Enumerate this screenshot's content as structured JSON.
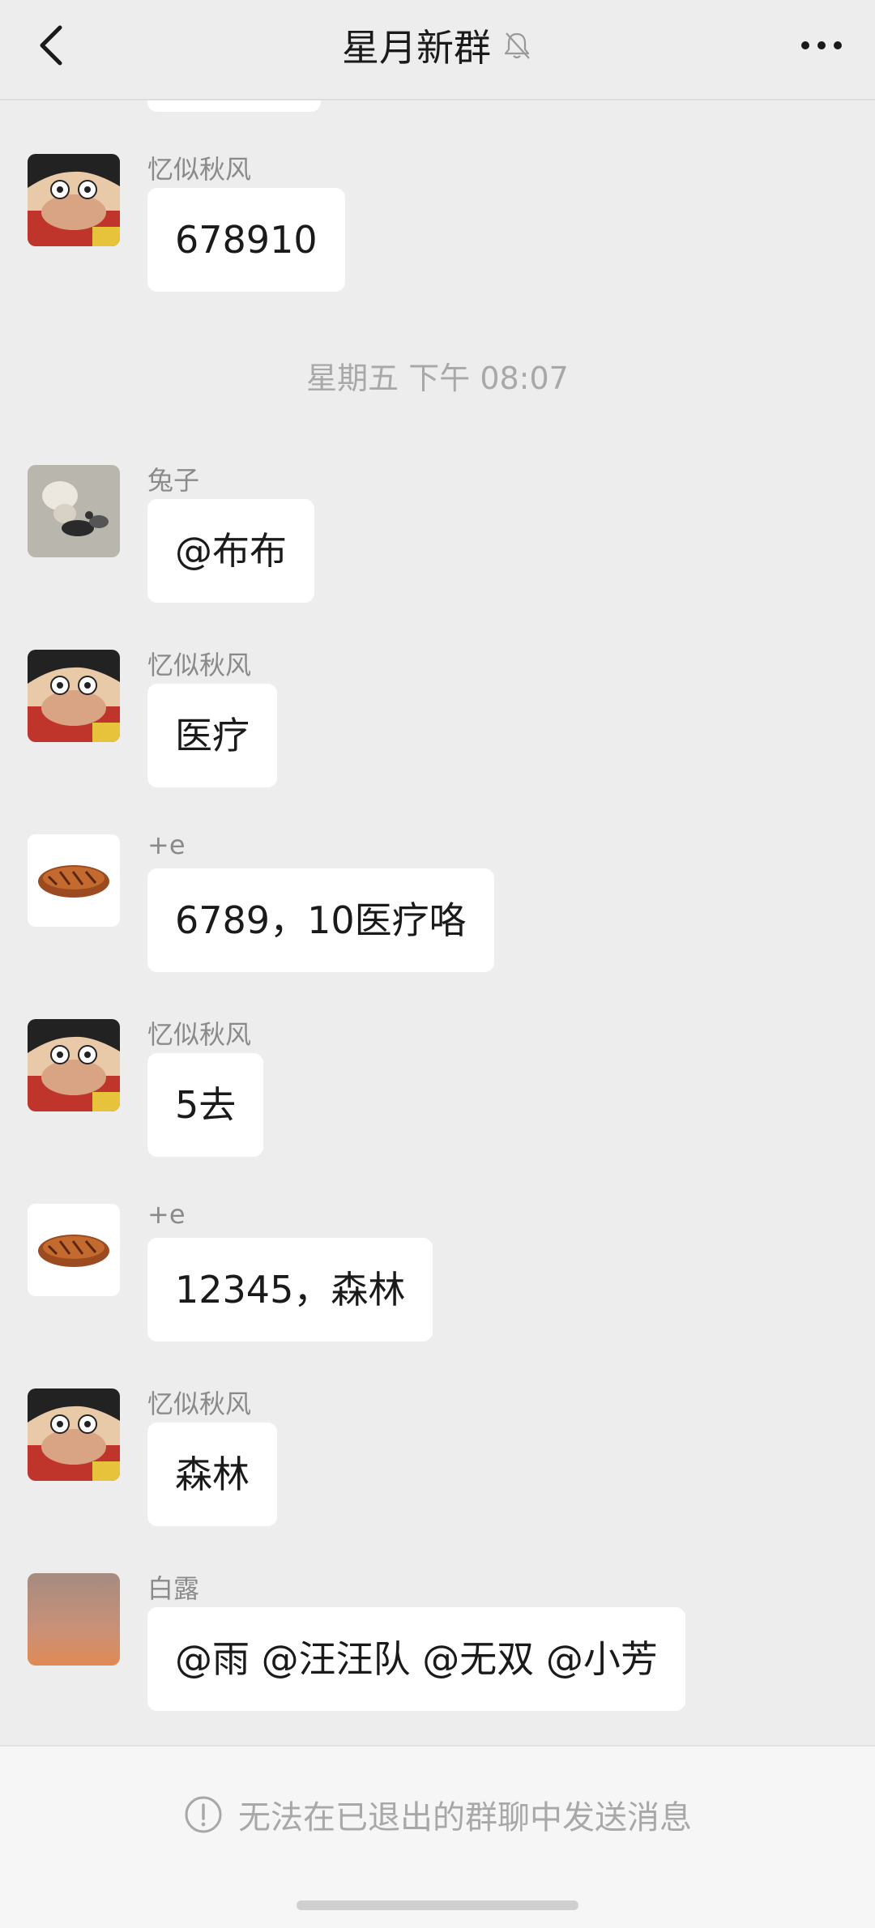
{
  "header": {
    "title": "星月新群",
    "mute_icon": "bell-off-icon",
    "back_icon": "chevron-left-icon",
    "more_icon": "more-dots-icon"
  },
  "timestamp": "星期五 下午 08:07",
  "messages": [
    {
      "sender": "忆似秋风",
      "text": "678910",
      "avatar": "luffy-avatar"
    },
    {
      "sender": "兔子",
      "text": "@布布",
      "avatar": "rabbit-photo-avatar"
    },
    {
      "sender": "忆似秋风",
      "text": "医疗",
      "avatar": "luffy-avatar"
    },
    {
      "sender": "+e",
      "text": "6789，10医疗咯",
      "avatar": "grilled-meat-avatar"
    },
    {
      "sender": "忆似秋风",
      "text": "5去",
      "avatar": "luffy-avatar"
    },
    {
      "sender": "+e",
      "text": "12345，森林",
      "avatar": "grilled-meat-avatar"
    },
    {
      "sender": "忆似秋风",
      "text": "森林",
      "avatar": "luffy-avatar"
    },
    {
      "sender": "白露",
      "text": "@雨 @汪汪队 @无双 @小芳",
      "avatar": "sunset-avatar"
    }
  ],
  "footer": {
    "notice": "无法在已退出的群聊中发送消息",
    "notice_icon": "info-circle-icon"
  },
  "colors": {
    "background": "#ededed",
    "bubble": "#ffffff",
    "meta_text": "#a8a8a8"
  }
}
